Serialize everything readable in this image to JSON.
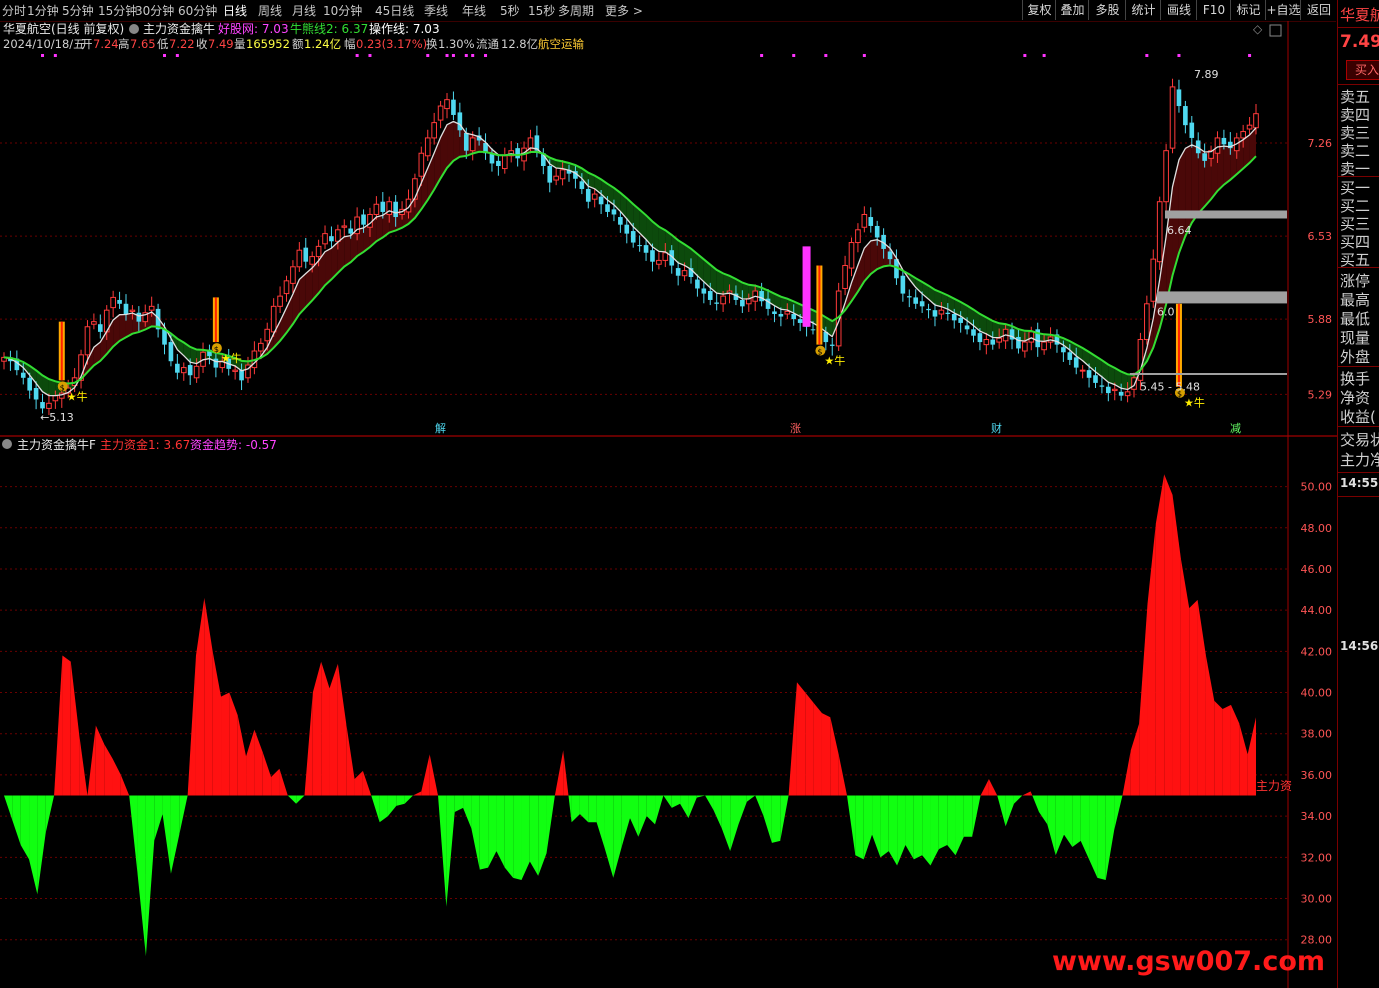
{
  "toolbar": {
    "tabs": [
      "分时",
      "1分钟",
      "5分钟",
      "15分钟",
      "30分钟",
      "60分钟",
      "日线",
      "周线",
      "月线",
      "10分钟",
      "45日线",
      "季线",
      "年线",
      "5秒",
      "15秒",
      "多周期",
      "更多 >"
    ],
    "active": "日线",
    "tools": [
      "复权",
      "叠加",
      "多股",
      "统计",
      "画线",
      "F10",
      "标记",
      "+自选",
      "返回"
    ]
  },
  "main": {
    "title": "华夏航空(日线 前复权)",
    "indicator": "主力资金擒牛",
    "hbw_label": "好股网: 7.03",
    "nxx_label": "牛熊线2: 6.37",
    "czx_label": "操作线: 7.03",
    "ohlc": {
      "date": "2024/10/18/五",
      "open_label": "开",
      "open": "7.24",
      "high_label": "高",
      "high": "7.65",
      "low_label": "低",
      "low": "7.22",
      "close_label": "收",
      "close": "7.49",
      "vol_label": "量",
      "vol": "165952",
      "amt_label": "额",
      "amt": "1.24亿",
      "chg_label": "幅",
      "chg": "0.23(3.17%)",
      "turn_label": "换",
      "turn": "1.30%",
      "float_label": "流通",
      "float": "12.8亿",
      "sector": "航空运输"
    },
    "price_ticks": [
      "7.26",
      "6.53",
      "5.88",
      "5.29"
    ],
    "annotations": {
      "hi": "7.89",
      "lo": "5.13",
      "a": "6.64",
      "b": "6.0",
      "range": "5.45 - 5.48",
      "signal": "★牛",
      "coin": "$"
    },
    "event_markers": [
      "解",
      "涨",
      "财",
      "减"
    ]
  },
  "sub": {
    "title": "主力资金擒牛F",
    "zl_label": "主力资金1: 3.67",
    "trend_label": "资金趋势: -0.57",
    "ticks": [
      "50.00",
      "48.00",
      "46.00",
      "44.00",
      "42.00",
      "40.00",
      "38.00",
      "36.00",
      "34.00",
      "32.00",
      "30.00",
      "28.00"
    ],
    "end_label": "主力资"
  },
  "right_panel": {
    "name": "华夏航",
    "price": "7.49",
    "buy_btn": "买入",
    "sell_rows": [
      "卖五",
      "卖四",
      "卖三",
      "卖二",
      "卖一"
    ],
    "buy_rows": [
      "买一",
      "买二",
      "买三",
      "买四",
      "买五"
    ],
    "stats": [
      "涨停",
      "最高",
      "最低",
      "现量",
      "外盘"
    ],
    "stats2": [
      "换手",
      "净资",
      "收益("
    ],
    "misc": [
      "交易状",
      "主力净"
    ],
    "time1": "14:55",
    "time2": "14:56"
  },
  "watermark": "www.gsw007.com",
  "colors": {
    "up": "#ff3a3a",
    "down": "#4fd9f0",
    "ma": "#e0e0e0",
    "green_line": "#33dd33",
    "grid": "#6a0000",
    "magenta": "#ff33ff"
  },
  "chart_data": [
    {
      "type": "candlestick",
      "title": "华夏航空(日线 前复权)",
      "ylim": [
        5.05,
        7.95
      ],
      "series_close": [
        5.58,
        5.55,
        5.48,
        5.42,
        5.32,
        5.25,
        5.18,
        5.22,
        5.28,
        5.3,
        5.34,
        5.42,
        5.6,
        5.82,
        5.86,
        5.78,
        5.95,
        6.05,
        6.0,
        5.92,
        5.95,
        5.86,
        5.93,
        5.98,
        5.8,
        5.68,
        5.55,
        5.46,
        5.5,
        5.44,
        5.51,
        5.62,
        5.59,
        5.5,
        5.55,
        5.49,
        5.48,
        5.4,
        5.52,
        5.63,
        5.69,
        5.8,
        5.98,
        6.06,
        6.18,
        6.29,
        6.42,
        6.33,
        6.37,
        6.45,
        6.55,
        6.49,
        6.58,
        6.61,
        6.55,
        6.68,
        6.62,
        6.7,
        6.78,
        6.72,
        6.8,
        6.68,
        6.74,
        6.82,
        6.98,
        7.18,
        7.3,
        7.42,
        7.55,
        7.6,
        7.48,
        7.36,
        7.2,
        7.3,
        7.28,
        7.18,
        7.1,
        7.08,
        7.16,
        7.2,
        7.14,
        7.22,
        7.3,
        7.2,
        7.08,
        6.95,
        7.0,
        7.05,
        7.02,
        6.98,
        6.9,
        6.8,
        6.86,
        6.78,
        6.72,
        6.7,
        6.62,
        6.55,
        6.48,
        6.46,
        6.4,
        6.33,
        6.34,
        6.4,
        6.3,
        6.22,
        6.26,
        6.21,
        6.12,
        6.08,
        6.03,
        6.0,
        6.06,
        6.1,
        6.03,
        5.98,
        6.04,
        6.1,
        6.02,
        5.96,
        5.92,
        5.9,
        5.94,
        5.88,
        5.85,
        5.82,
        5.8,
        5.76,
        5.7,
        5.67,
        6.1,
        6.3,
        6.48,
        6.58,
        6.7,
        6.61,
        6.52,
        6.43,
        6.35,
        6.2,
        6.08,
        6.05,
        6.0,
        5.98,
        5.95,
        5.9,
        5.95,
        5.92,
        5.87,
        5.85,
        5.8,
        5.75,
        5.7,
        5.72,
        5.68,
        5.73,
        5.8,
        5.72,
        5.65,
        5.7,
        5.78,
        5.66,
        5.7,
        5.74,
        5.68,
        5.62,
        5.56,
        5.5,
        5.48,
        5.42,
        5.38,
        5.35,
        5.3,
        5.33,
        5.28,
        5.31,
        5.42,
        5.72,
        6.0,
        6.35,
        6.8,
        7.2,
        7.7,
        7.55,
        7.4,
        7.3,
        7.18,
        7.12,
        7.2,
        7.3,
        7.25,
        7.22,
        7.3,
        7.35,
        7.4,
        7.49
      ]
    },
    {
      "type": "area",
      "title": "主力资金擒牛F",
      "baseline": 35.0,
      "ylim": [
        27.5,
        51.0
      ],
      "values": [
        35.0,
        33.8,
        32.6,
        31.9,
        30.2,
        33.2,
        35.0,
        41.8,
        41.5,
        38.0,
        35.0,
        38.4,
        37.5,
        36.8,
        36.0,
        35.0,
        31.2,
        27.2,
        32.8,
        34.1,
        31.2,
        33.1,
        35.0,
        41.8,
        44.6,
        42.0,
        39.8,
        40.0,
        38.9,
        36.9,
        38.2,
        37.1,
        35.9,
        36.3,
        35.0,
        34.6,
        35.0,
        40.0,
        41.5,
        40.2,
        41.4,
        38.5,
        35.8,
        36.2,
        35.0,
        33.7,
        34.0,
        34.5,
        34.6,
        35.0,
        35.2,
        37.0,
        35.0,
        29.6,
        34.2,
        34.4,
        33.4,
        31.4,
        31.5,
        32.3,
        31.5,
        31.0,
        30.9,
        31.8,
        31.1,
        32.2,
        35.0,
        37.2,
        33.7,
        34.1,
        33.7,
        33.7,
        32.4,
        31.0,
        32.5,
        33.9,
        33.0,
        34.0,
        33.6,
        35.0,
        34.4,
        34.6,
        33.9,
        34.9,
        35.0,
        34.3,
        33.4,
        32.3,
        33.6,
        34.7,
        35.0,
        34.0,
        32.7,
        32.8,
        35.0,
        40.5,
        40.0,
        39.5,
        39.0,
        38.8,
        37.0,
        35.0,
        32.1,
        31.9,
        33.1,
        32.0,
        32.3,
        31.6,
        32.6,
        31.9,
        32.1,
        31.6,
        32.4,
        32.6,
        32.1,
        33.0,
        33.0,
        35.0,
        35.8,
        35.0,
        33.5,
        34.6,
        35.0,
        35.2,
        34.2,
        33.6,
        32.1,
        33.1,
        32.5,
        32.8,
        31.9,
        31.0,
        30.9,
        33.3,
        35.0,
        37.2,
        38.5,
        44.3,
        48.2,
        50.6,
        49.6,
        46.5,
        44.1,
        44.5,
        41.8,
        39.6,
        39.2,
        39.4,
        38.5,
        37.0,
        38.8
      ]
    }
  ]
}
